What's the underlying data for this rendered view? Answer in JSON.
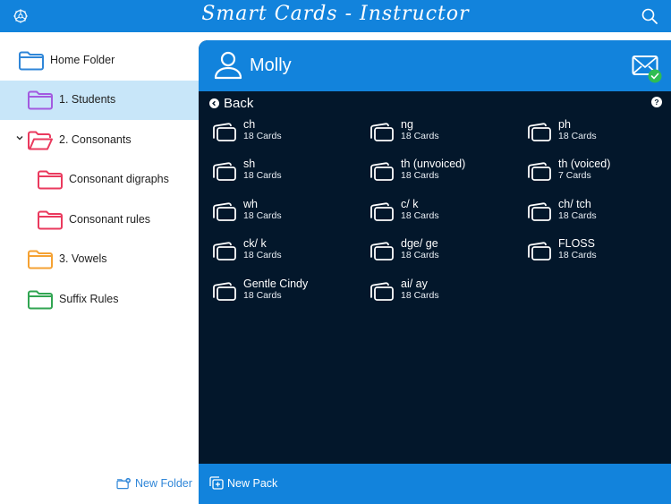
{
  "app": {
    "title": "Smart Cards - Instructor",
    "accent_color": "#1283dc",
    "dark_bg": "#03172b"
  },
  "topbar": {
    "settings_icon": "gear-icon",
    "search_icon": "search-icon"
  },
  "sidebar": {
    "folders": [
      {
        "label": "Home Folder",
        "color": "#2f86d8",
        "indent": 0,
        "selected": false,
        "expanded": false
      },
      {
        "label": "1. Students",
        "color": "#a35be0",
        "indent": 1,
        "selected": true,
        "expanded": false
      },
      {
        "label": "2. Consonants",
        "color": "#ea3a5e",
        "indent": 1,
        "selected": false,
        "expanded": true
      },
      {
        "label": "Consonant digraphs",
        "color": "#ea3a5e",
        "indent": 2,
        "selected": false,
        "expanded": false
      },
      {
        "label": "Consonant rules",
        "color": "#ea3a5e",
        "indent": 2,
        "selected": false,
        "expanded": false
      },
      {
        "label": "3. Vowels",
        "color": "#f5a233",
        "indent": 1,
        "selected": false,
        "expanded": false
      },
      {
        "label": "Suffix Rules",
        "color": "#31a552",
        "indent": 1,
        "selected": false,
        "expanded": false
      }
    ],
    "new_folder_label": "New Folder"
  },
  "panel": {
    "student_name": "Molly",
    "back_label": "Back",
    "mail_status": "sent",
    "help_label": "?",
    "packs": [
      {
        "name": "ch",
        "count": "18 Cards"
      },
      {
        "name": "ng",
        "count": "18 Cards"
      },
      {
        "name": "ph",
        "count": "18 Cards"
      },
      {
        "name": "sh",
        "count": "18 Cards"
      },
      {
        "name": "th (unvoiced)",
        "count": "18 Cards"
      },
      {
        "name": "th (voiced)",
        "count": "7 Cards"
      },
      {
        "name": "wh",
        "count": "18 Cards"
      },
      {
        "name": "c/ k",
        "count": "18 Cards"
      },
      {
        "name": "ch/ tch",
        "count": "18 Cards"
      },
      {
        "name": "ck/ k",
        "count": "18 Cards"
      },
      {
        "name": "dge/ ge",
        "count": "18 Cards"
      },
      {
        "name": "FLOSS",
        "count": "18 Cards"
      },
      {
        "name": "Gentle Cindy",
        "count": "18 Cards"
      },
      {
        "name": "ai/ ay",
        "count": "18 Cards"
      }
    ],
    "new_pack_label": "New Pack"
  }
}
